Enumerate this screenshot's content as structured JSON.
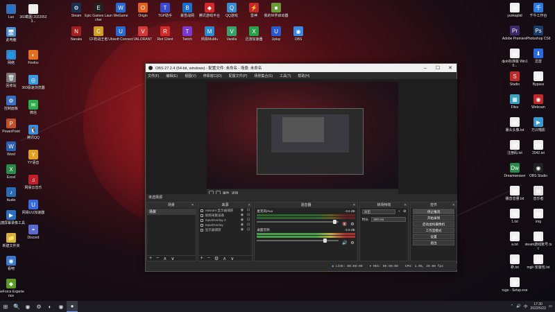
{
  "desktop": {
    "left_icons": [
      {
        "label": "Luo",
        "color": "#3a6fb0",
        "glyph": "👤"
      },
      {
        "label": "此电脑",
        "color": "#4a90d0",
        "glyph": "🖥"
      },
      {
        "label": "网络",
        "color": "#3a80c8",
        "glyph": "🌐"
      },
      {
        "label": "回收站",
        "color": "#777",
        "glyph": "🗑"
      },
      {
        "label": "控制面板",
        "color": "#3a70c0",
        "glyph": "⚙"
      },
      {
        "label": "PowerPoint",
        "color": "#c4502a",
        "glyph": "P"
      },
      {
        "label": "Word",
        "color": "#2b5fb0",
        "glyph": "W"
      },
      {
        "label": "Excel",
        "color": "#2a8a4a",
        "glyph": "X"
      },
      {
        "label": "Audio",
        "color": "#2a6ab0",
        "glyph": "♪"
      },
      {
        "label": "迅捷屏幕录像工具",
        "color": "#2a70c0",
        "glyph": "▶"
      },
      {
        "label": "新建文件夹",
        "color": "#d8b040",
        "glyph": "📁"
      },
      {
        "label": "看吧",
        "color": "#3a78d0",
        "glyph": "◉"
      },
      {
        "label": "GeForce Experience",
        "color": "#5a9a20",
        "glyph": "◆"
      }
    ],
    "col2_icons": [
      {
        "label": "360截图 20220523...",
        "color": "#eee",
        "glyph": "▭"
      },
      {
        "label": "Firefox",
        "color": "#e07020",
        "glyph": "◐"
      },
      {
        "label": "360极速浏览器",
        "color": "#3a9ae0",
        "glyph": "◎"
      },
      {
        "label": "微信",
        "color": "#2ab04a",
        "glyph": "✉"
      },
      {
        "label": "腾讯QQ",
        "color": "#3a8ae0",
        "glyph": "🐧"
      },
      {
        "label": "YY语音",
        "color": "#e0a020",
        "glyph": "Y"
      },
      {
        "label": "网易云音乐",
        "color": "#c0202a",
        "glyph": "♫"
      },
      {
        "label": "网易UU加速器",
        "color": "#3a6ae0",
        "glyph": "U"
      },
      {
        "label": "Discord",
        "color": "#5a6ad0",
        "glyph": "◓"
      }
    ],
    "top_icons": [
      {
        "label": "Steam",
        "color": "#1a3050",
        "glyph": "⚙"
      },
      {
        "label": "Epic Games Launcher",
        "color": "#222",
        "glyph": "E"
      },
      {
        "label": "WeGame",
        "color": "#2a6ad0",
        "glyph": "W"
      },
      {
        "label": "Origin",
        "color": "#e06020",
        "glyph": "O"
      },
      {
        "label": "TGP助手",
        "color": "#3a4ad0",
        "glyph": "T"
      },
      {
        "label": "暴雪战网",
        "color": "#1a70d0",
        "glyph": "B"
      },
      {
        "label": "腾讯游戏平台",
        "color": "#d02a2a",
        "glyph": "◆"
      },
      {
        "label": "QQ游戏",
        "color": "#3a8ad0",
        "glyph": "Q"
      },
      {
        "label": "雷神",
        "color": "#c02a2a",
        "glyph": "⚡"
      },
      {
        "label": "我的世界启动器",
        "color": "#6a9a3a",
        "glyph": "■"
      }
    ],
    "row2_icons": [
      {
        "label": "Naraka",
        "color": "#a02020",
        "glyph": "N"
      },
      {
        "label": "CF枪战王者",
        "color": "#d0a020",
        "glyph": "C"
      },
      {
        "label": "Ubisoft Connect",
        "color": "#2a6ad0",
        "glyph": "U"
      },
      {
        "label": "VALORANT",
        "color": "#d03a3a",
        "glyph": "V"
      },
      {
        "label": "Riot Client",
        "color": "#d02a2a",
        "glyph": "R"
      },
      {
        "label": "Twitch",
        "color": "#7a3ad0",
        "glyph": "T"
      },
      {
        "label": "网易MuMu",
        "color": "#2a8ad0",
        "glyph": "M"
      },
      {
        "label": "Vanilla",
        "color": "#3aa06a",
        "glyph": "V"
      },
      {
        "label": "迅游加速器",
        "color": "#2aa04a",
        "glyph": "X"
      },
      {
        "label": "Uplay",
        "color": "#2a5ad0",
        "glyph": "U"
      },
      {
        "label": "OBS",
        "color": "#3a8ae0",
        "glyph": "◉"
      }
    ],
    "right_icons": [
      {
        "label": "yunkaptid",
        "color": "#eee",
        "glyph": "▤"
      },
      {
        "label": "千牛工作台",
        "color": "#2a7ae0",
        "glyph": "千"
      },
      {
        "label": "Adobe Premiere",
        "color": "#3a2a6a",
        "glyph": "Pr"
      },
      {
        "label": "Photoshop CS6",
        "color": "#1a3a6a",
        "glyph": "Ps"
      },
      {
        "label": "djob标准版 Win10...",
        "color": "#eee",
        "glyph": "▤"
      },
      {
        "label": "迅雷",
        "color": "#2a6ae0",
        "glyph": "⬇"
      },
      {
        "label": "Studio",
        "color": "#c02a2a",
        "glyph": "S"
      },
      {
        "label": "Bypass",
        "color": "#eee",
        "glyph": "▤"
      },
      {
        "label": "Files",
        "color": "#3aa0c0",
        "glyph": "▦"
      },
      {
        "label": "Webcam",
        "color": "#c02a2a",
        "glyph": "◉"
      },
      {
        "label": "暴头头像.txt",
        "color": "#eee",
        "glyph": "▤"
      },
      {
        "label": "万兴喵影",
        "color": "#3a9ad0",
        "glyph": "▶"
      },
      {
        "label": "注册码.txt",
        "color": "#eee",
        "glyph": "▤"
      },
      {
        "label": "2042.txt",
        "color": "#eee",
        "glyph": "▤"
      },
      {
        "label": "Dreamweaver",
        "color": "#2a8a4a",
        "glyph": "Dw"
      },
      {
        "label": "OBS Studio",
        "color": "#222",
        "glyph": "◉"
      },
      {
        "label": "播音音量.txt",
        "color": "#eee",
        "glyph": "▤"
      },
      {
        "label": "音乐者",
        "color": "#e0e0e0",
        "glyph": "▤"
      },
      {
        "label": "1.txt",
        "color": "#eee",
        "glyph": "▤"
      },
      {
        "label": "img",
        "color": "#eee",
        "glyph": "▤"
      },
      {
        "label": "a.txt",
        "color": "#eee",
        "glyph": "▤"
      },
      {
        "label": "steam游戏账号.txt",
        "color": "#eee",
        "glyph": "▤"
      },
      {
        "label": "新.txt",
        "color": "#eee",
        "glyph": "▤"
      },
      {
        "label": "mglr-安装包.txt",
        "color": "#eee",
        "glyph": "▤"
      },
      {
        "label": "rugo - Setup.exe",
        "color": "#eee",
        "glyph": "▤"
      }
    ]
  },
  "obs": {
    "title": "OBS 27.2.4 (64-bit, windows) - 配置文件: 未命名 - 场景: 未命名",
    "menu": [
      "文件(F)",
      "编辑(E)",
      "视图(V)",
      "停靠窗口(D)",
      "配置文件(P)",
      "场景集合(S)",
      "工具(T)",
      "帮助(H)"
    ],
    "scene_status": "未选择源",
    "docks": {
      "scenes_title": "场景",
      "sources_title": "来源",
      "mixer_title": "混音器",
      "transitions_title": "转场特效",
      "controls_title": "控件"
    },
    "scenes": [
      "场景"
    ],
    "sources": [
      "valorant 显示器捕获",
      "视频采集设备",
      "InputOverlay 2",
      "InputOverlay",
      "显示器捕获"
    ],
    "mixer": [
      {
        "name": "麦克风/Aux",
        "db": "-3.5 dB"
      },
      {
        "name": "桌面音频",
        "db": "-2.8 dB"
      }
    ],
    "transition": {
      "type": "淡出",
      "duration_label": "时长",
      "duration": "300 ms"
    },
    "controls": [
      "停止推流",
      "开始录制",
      "启动虚拟摄像机",
      "工作室模式",
      "设置",
      "退出"
    ],
    "status": {
      "live": "LIVE: 00:00:00",
      "rec": "REC: 00:00:00",
      "cpu": "CPU: 1.0%, 30.00 fps"
    },
    "preview_btn_a": "属性",
    "preview_btn_b": "滤镜"
  },
  "taskbar": {
    "time": "17:30",
    "date": "2022/5/23",
    "apps": [
      "⊞",
      "🔍",
      "◉",
      "⚙",
      "◐",
      "◉",
      "●"
    ],
    "tray": [
      "⌃",
      "🔊",
      "中"
    ]
  }
}
